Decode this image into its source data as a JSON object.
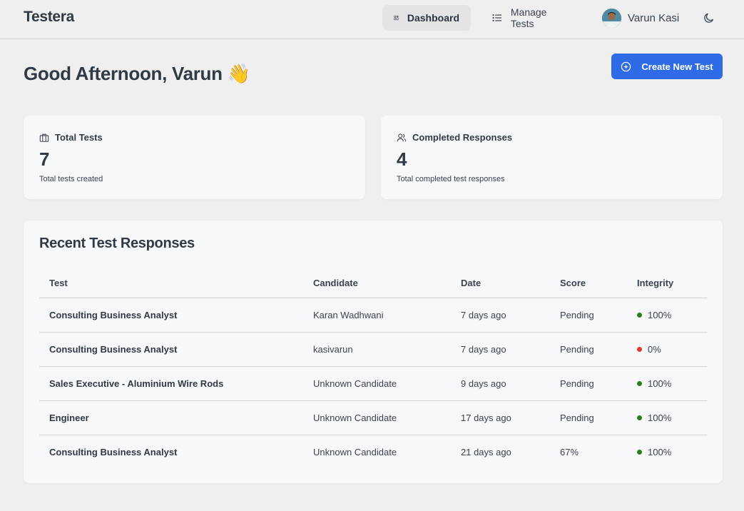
{
  "brand": "Testera",
  "nav": {
    "dashboard_label": "Dashboard",
    "manage_label": "Manage Tests",
    "user_name": "Varun Kasi"
  },
  "greeting": "Good Afternoon, Varun",
  "greeting_emoji": "👋",
  "create_button": "Create New Test",
  "stats": {
    "total_tests": {
      "label": "Total Tests",
      "value": "7",
      "sub": "Total tests created"
    },
    "completed": {
      "label": "Completed Responses",
      "value": "4",
      "sub": "Total completed test responses"
    }
  },
  "recent": {
    "title": "Recent Test Responses",
    "columns": [
      "Test",
      "Candidate",
      "Date",
      "Score",
      "Integrity"
    ],
    "rows": [
      {
        "test": "Consulting Business Analyst",
        "candidate": "Karan Wadhwani",
        "date": "7 days ago",
        "score": "Pending",
        "integrity": "100%",
        "status_color": "#2e7d1f"
      },
      {
        "test": "Consulting Business Analyst",
        "candidate": "kasivarun",
        "date": "7 days ago",
        "score": "Pending",
        "integrity": "0%",
        "status_color": "#e53935"
      },
      {
        "test": "Sales Executive - Aluminium Wire Rods",
        "candidate": "Unknown Candidate",
        "date": "9 days ago",
        "score": "Pending",
        "integrity": "100%",
        "status_color": "#2e7d1f"
      },
      {
        "test": "Engineer",
        "candidate": "Unknown Candidate",
        "date": "17 days ago",
        "score": "Pending",
        "integrity": "100%",
        "status_color": "#2e7d1f"
      },
      {
        "test": "Consulting Business Analyst",
        "candidate": "Unknown Candidate",
        "date": "21 days ago",
        "score": "67%",
        "integrity": "100%",
        "status_color": "#2e7d1f"
      }
    ]
  },
  "colors": {
    "accent": "#2f6be6",
    "success": "#2e7d1f",
    "danger": "#e53935"
  },
  "icons": {
    "dashboard": "grid-icon",
    "manage": "list-icon",
    "theme": "moon-icon",
    "create": "plus-circle-icon",
    "total_tests": "briefcase-icon",
    "completed": "users-icon"
  }
}
